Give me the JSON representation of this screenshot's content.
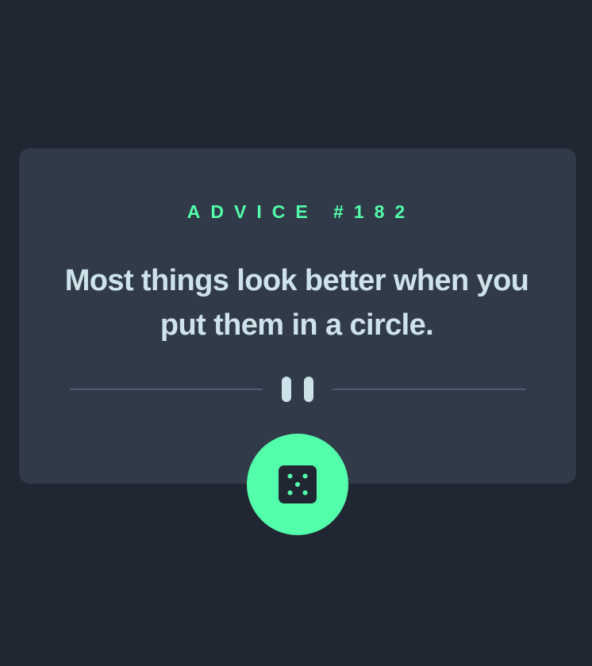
{
  "advice": {
    "label": "ADVICE #182",
    "quote": "Most things look better when you put them in a circle."
  },
  "icons": {
    "divider": "pause-icon",
    "button": "dice-icon"
  },
  "colors": {
    "background": "#202632",
    "card": "#313a48",
    "accent": "#53ffab",
    "text": "#cee3e9",
    "divider": "#4f5d74"
  }
}
